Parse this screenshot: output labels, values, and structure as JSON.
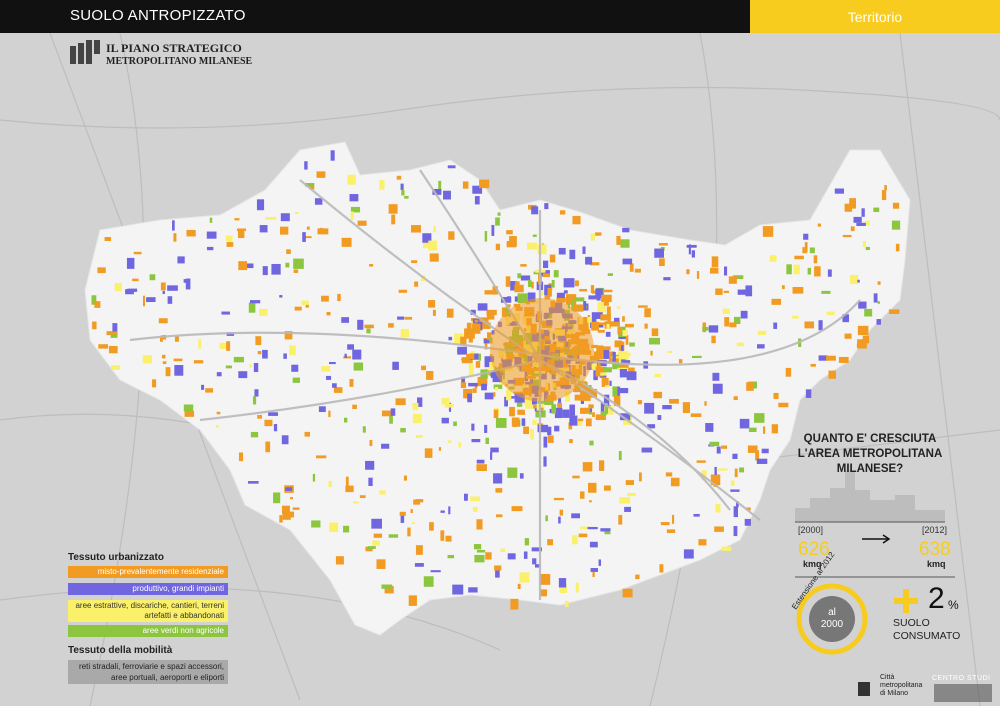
{
  "header": {
    "title": "SUOLO ANTROPIZZATO",
    "section": "Territorio"
  },
  "logo": {
    "line1": "IL PIANO STRATEGICO",
    "line2": "METROPOLITANO MILANESE"
  },
  "legend": {
    "urban_title": "Tessuto urbanizzato",
    "items": [
      {
        "label": "misto-prevalentemente residenziale",
        "color": "#f29b22"
      },
      {
        "label": "produttivo, grandi impianti",
        "color": "#7066e0"
      },
      {
        "label": "aree estrattive, discariche, cantieri, terreni artefatti e abbandonati",
        "color": "#fbf06a"
      },
      {
        "label": "aree verdi non agricole",
        "color": "#8cc63f"
      }
    ],
    "mobility_title": "Tessuto della mobilità",
    "mobility_item": {
      "label": "reti stradali, ferroviarie e spazi accessori, aree portuali, aeroporti e eliporti",
      "color": "#a9a9a9"
    }
  },
  "infobox": {
    "question": "QUANTO E' CRESCIUTA L'AREA METROPOLITANA MILANESE?",
    "year_start": "[2000]",
    "year_end": "[2012]",
    "value_start": "626",
    "value_end": "638",
    "unit": "kmq",
    "ring_outer": "Estensione al 2012",
    "ring_inner_1": "al",
    "ring_inner_2": "2000",
    "growth": "2",
    "growth_unit": "%",
    "growth_label_1": "SUOLO",
    "growth_label_2": "CONSUMATO"
  },
  "footer": {
    "org_1": "Città",
    "org_2": "metropolitana",
    "org_3": "di Milano",
    "centro": "CENTRO STUDI"
  },
  "colors": {
    "yellow": "#f7cc1f",
    "orange": "#f29b22",
    "blue": "#7066e0",
    "green": "#8cc63f",
    "gray": "#a9a9a9",
    "light": "#f4f4f4"
  }
}
